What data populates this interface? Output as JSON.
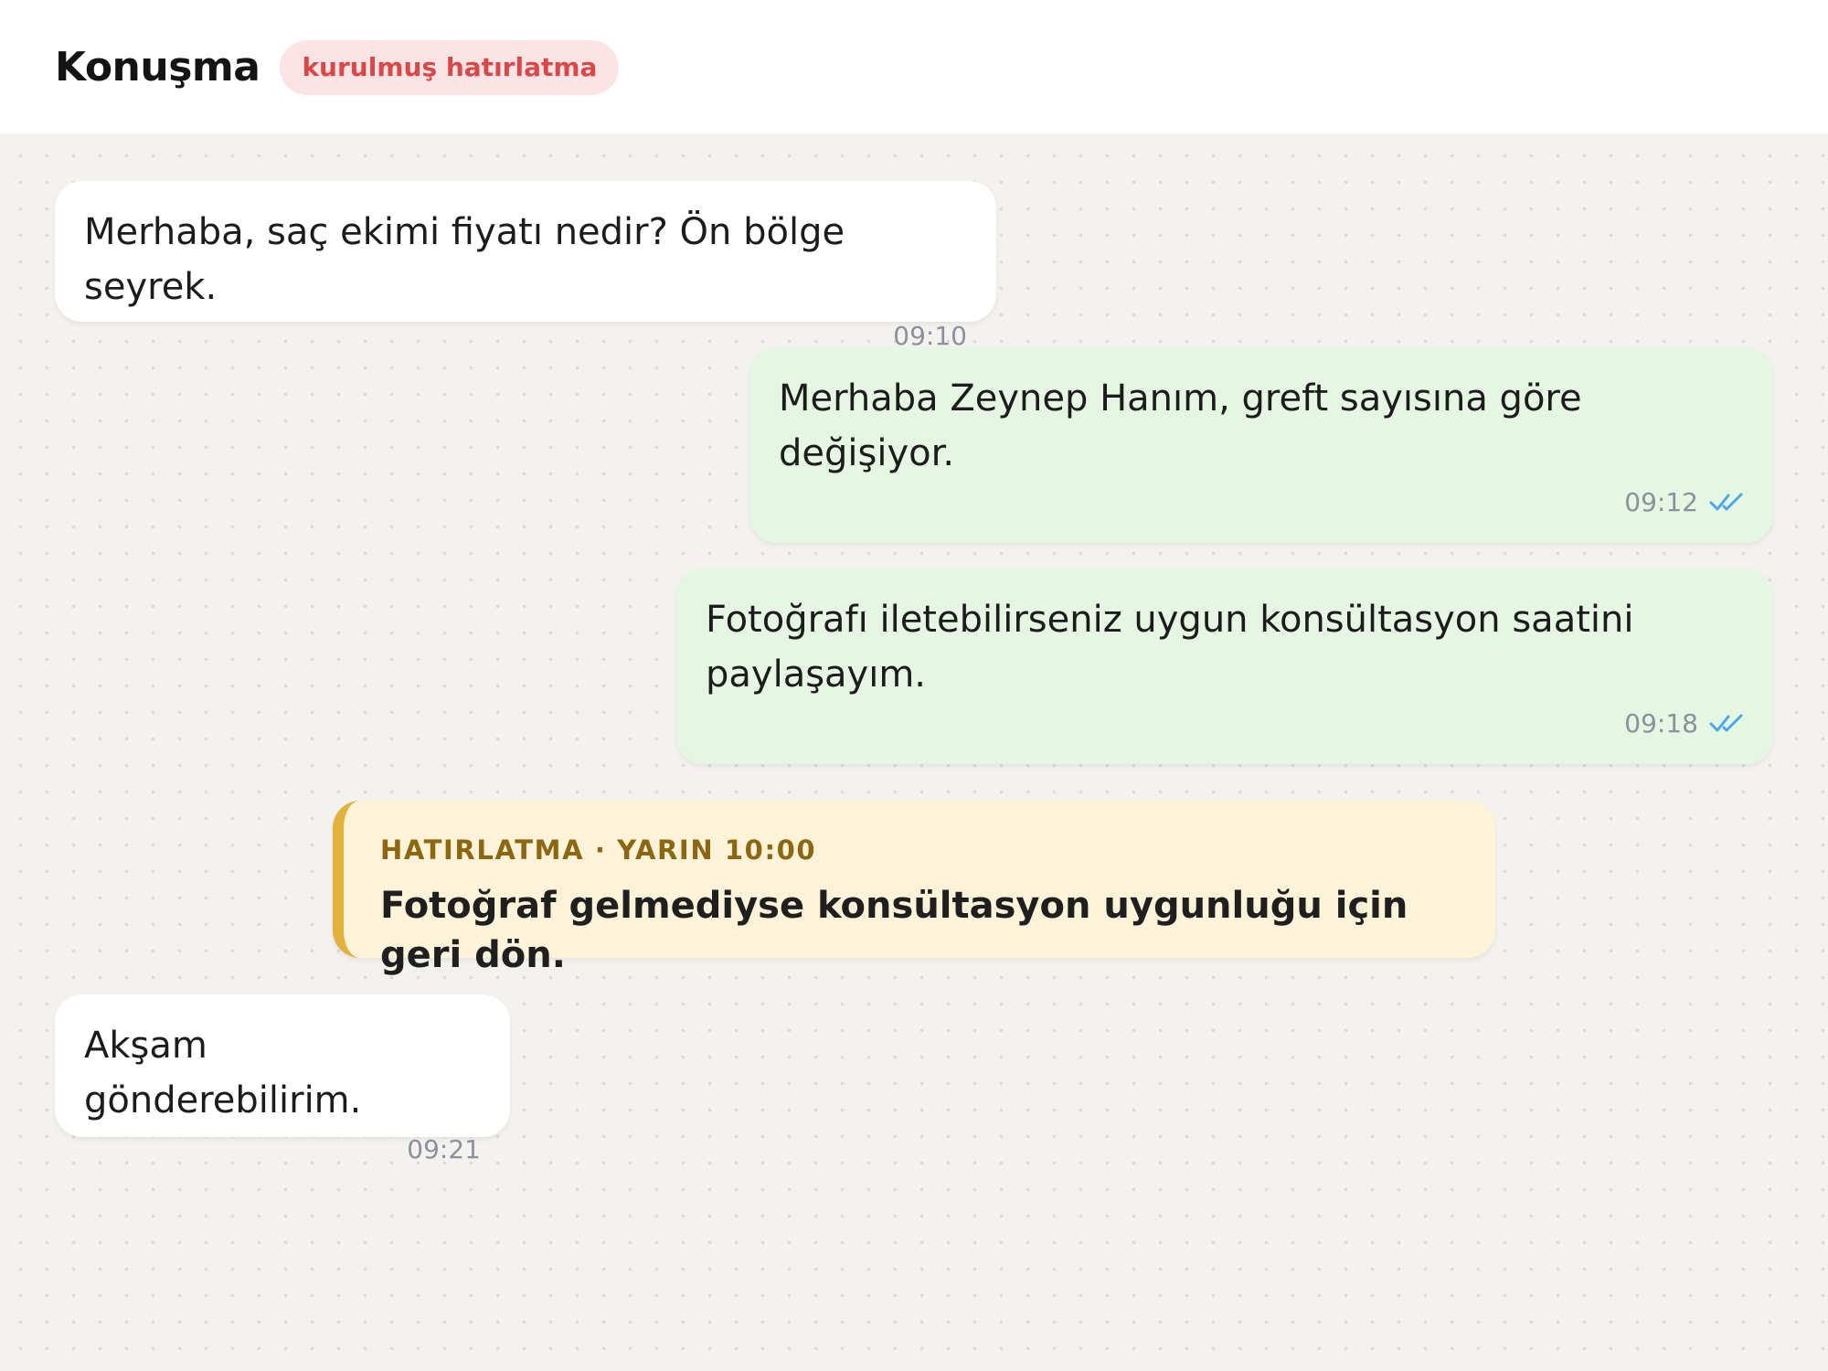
{
  "header": {
    "title": "Konuşma",
    "badge": "kurulmuş hatırlatma"
  },
  "messages": [
    {
      "direction": "incoming",
      "text": "Merhaba, saç ekimi fiyatı nedir? Ön bölge seyrek.",
      "time": "09:10"
    },
    {
      "direction": "outgoing",
      "text": "Merhaba Zeynep Hanım, greft sayısına göre değişiyor.",
      "time": "09:12",
      "status": "read",
      "status_icon": "double-check-icon"
    },
    {
      "direction": "outgoing",
      "text": "Fotoğrafı iletebilirseniz uygun konsültasyon saatini paylaşayım.",
      "time": "09:18",
      "status": "read",
      "status_icon": "double-check-icon"
    },
    {
      "direction": "incoming",
      "text": "Akşam gönderebilirim.",
      "time": "09:21"
    }
  ],
  "reminder": {
    "label": "HATIRLATMA · YARIN 10:00",
    "text": "Fotoğraf gelmediyse konsültasyon uygunluğu için geri dön."
  },
  "colors": {
    "chat_background": "#f4f2ee",
    "incoming_bubble": "#ffffff",
    "outgoing_bubble": "#e5f6e2",
    "badge_background": "#fde4e4",
    "badge_text": "#d94848",
    "reminder_background": "#fdf3d8",
    "reminder_accent": "#e3b23c",
    "reminder_label": "#8c6610",
    "read_tick": "#4aa8e8",
    "timestamp": "#8a919c"
  }
}
